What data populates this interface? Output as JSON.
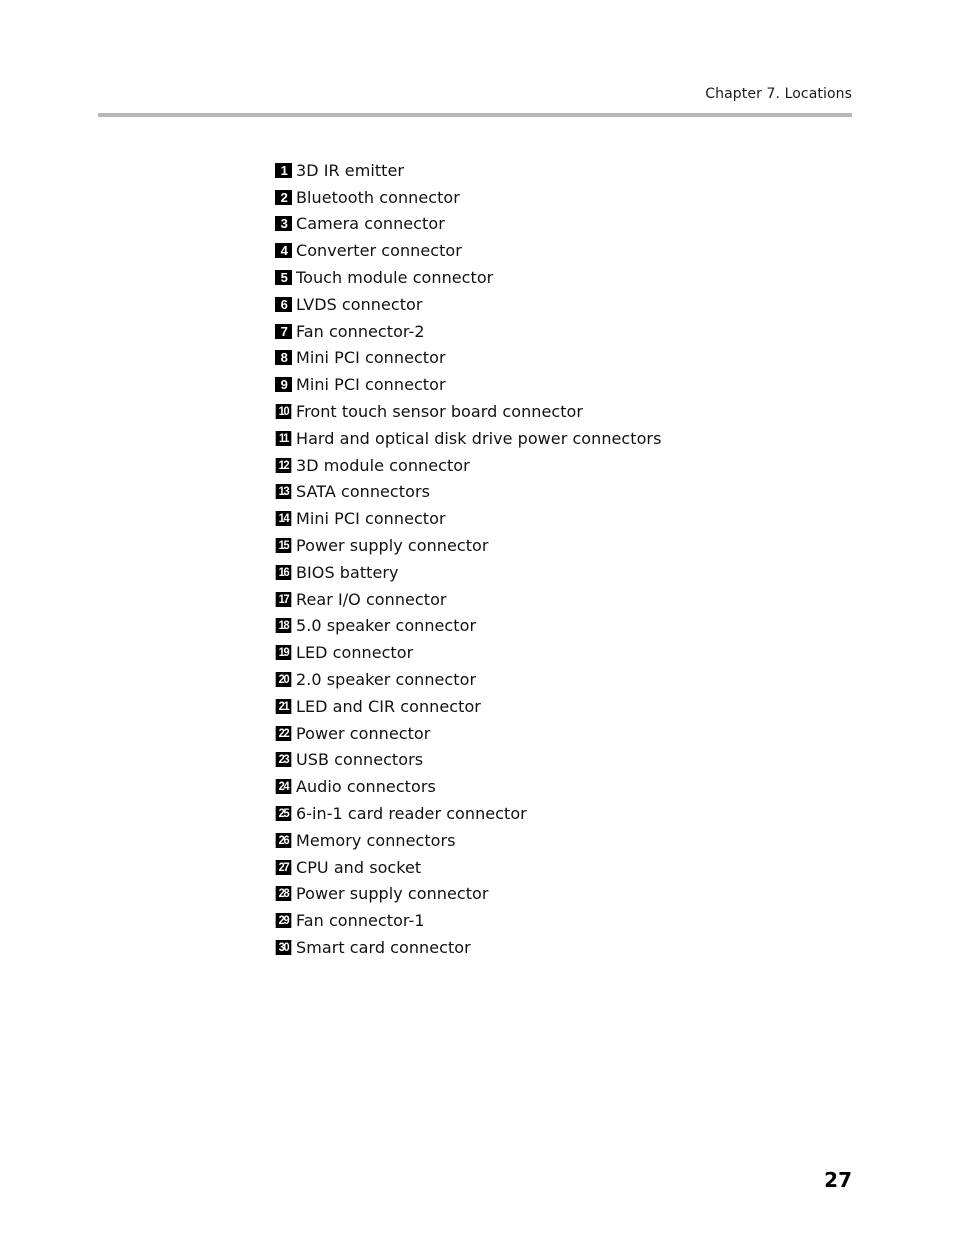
{
  "header": {
    "running_head": "Chapter 7. Locations"
  },
  "legend": {
    "items": [
      {
        "number": "1",
        "label": "3D IR emitter"
      },
      {
        "number": "2",
        "label": "Bluetooth connector"
      },
      {
        "number": "3",
        "label": "Camera connector"
      },
      {
        "number": "4",
        "label": "Converter connector"
      },
      {
        "number": "5",
        "label": "Touch module connector"
      },
      {
        "number": "6",
        "label": "LVDS connector"
      },
      {
        "number": "7",
        "label": "Fan connector-2"
      },
      {
        "number": "8",
        "label": "Mini PCI connector"
      },
      {
        "number": "9",
        "label": "Mini PCI connector"
      },
      {
        "number": "10",
        "label": "Front touch sensor board connector"
      },
      {
        "number": "11",
        "label": "Hard and optical disk drive power connectors"
      },
      {
        "number": "12",
        "label": "3D module connector"
      },
      {
        "number": "13",
        "label": "SATA connectors"
      },
      {
        "number": "14",
        "label": "Mini PCI connector"
      },
      {
        "number": "15",
        "label": "Power supply connector"
      },
      {
        "number": "16",
        "label": "BIOS battery"
      },
      {
        "number": "17",
        "label": "Rear I/O connector"
      },
      {
        "number": "18",
        "label": "5.0 speaker connector"
      },
      {
        "number": "19",
        "label": "LED connector"
      },
      {
        "number": "20",
        "label": "2.0 speaker connector"
      },
      {
        "number": "21",
        "label": "LED and CIR connector"
      },
      {
        "number": "22",
        "label": "Power connector"
      },
      {
        "number": "23",
        "label": "USB connectors"
      },
      {
        "number": "24",
        "label": "Audio connectors"
      },
      {
        "number": "25",
        "label": "6-in-1 card reader connector"
      },
      {
        "number": "26",
        "label": "Memory connectors"
      },
      {
        "number": "27",
        "label": "CPU and socket"
      },
      {
        "number": "28",
        "label": "Power supply connector"
      },
      {
        "number": "29",
        "label": "Fan connector-1"
      },
      {
        "number": "30",
        "label": "Smart card connector"
      }
    ]
  },
  "footer": {
    "page_number": "27"
  }
}
